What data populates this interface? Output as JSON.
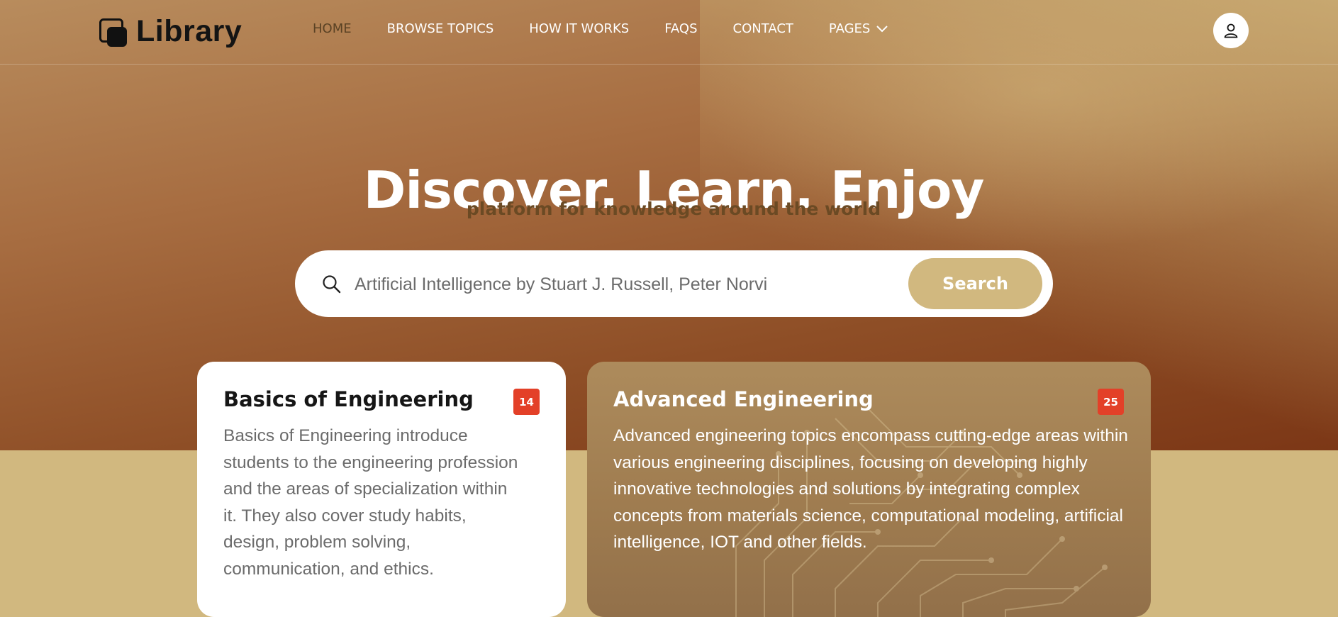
{
  "brand": {
    "name": "Library",
    "icon": "library-logo-icon"
  },
  "nav": {
    "items": [
      {
        "label": "HOME",
        "active": true
      },
      {
        "label": "BROWSE TOPICS"
      },
      {
        "label": "HOW IT WORKS"
      },
      {
        "label": "FAQS"
      },
      {
        "label": "CONTACT"
      },
      {
        "label": "PAGES",
        "icon": "chevron-down-icon"
      }
    ],
    "user_icon": "user-icon"
  },
  "hero": {
    "title": "Discover. Learn. Enjoy",
    "subtitle": "platform for knowledge around the world"
  },
  "search": {
    "value": "Artificial Intelligence by Stuart J. Russell, Peter Norvi",
    "button_label": "Search",
    "icon": "search-icon"
  },
  "cards": [
    {
      "title": "Basics of Engineering",
      "badge": "14",
      "description": "Basics of Engineering introduce students to the engineering profession and the areas of specialization within it. They also cover study habits, design, problem solving, communication, and ethics."
    },
    {
      "title": "Advanced Engineering",
      "badge": "25",
      "description": "Advanced engineering topics encompass cutting-edge areas within various engineering disciplines, focusing on developing highly innovative technologies and solutions by integrating complex concepts from materials science, computational modeling, artificial intelligence, IOT and other fields."
    }
  ],
  "colors": {
    "accent": "#d1b87f",
    "badge": "#e34028",
    "hero_dark": "#8e4e26",
    "subtitle": "#6b4a24"
  }
}
